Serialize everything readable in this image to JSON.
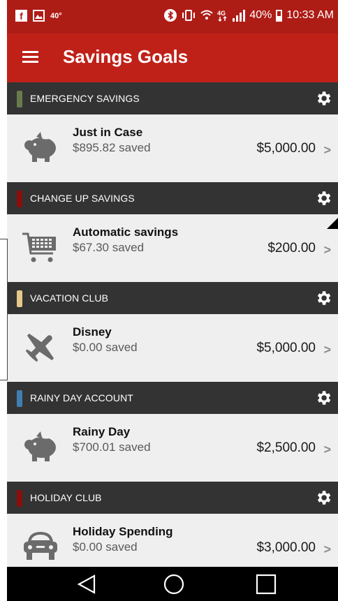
{
  "status_bar": {
    "temperature": "40°",
    "battery_percent": "40%",
    "time": "10:33 AM",
    "icons": [
      "facebook-icon",
      "gallery-icon",
      "bluetooth-icon",
      "vibrate-icon",
      "wifi-icon",
      "lte-icon",
      "signal-icon",
      "battery-icon"
    ]
  },
  "app_bar": {
    "title": "Savings Goals",
    "menu_icon": "hamburger-menu-icon"
  },
  "sections": [
    {
      "category": "EMERGENCY SAVINGS",
      "swatch_color": "#6b7a4d",
      "goal": {
        "name": "Just in Case",
        "saved": "$895.82 saved",
        "target": "$5,000.00",
        "icon": "piggy-bank-icon"
      }
    },
    {
      "category": "CHANGE UP SAVINGS",
      "swatch_color": "#8a0e0e",
      "goal": {
        "name": "Automatic savings",
        "saved": "$67.30 saved",
        "target": "$200.00",
        "icon": "shopping-cart-icon"
      }
    },
    {
      "category": "VACATION CLUB",
      "swatch_color": "#e6c88a",
      "goal": {
        "name": "Disney",
        "saved": "$0.00 saved",
        "target": "$5,000.00",
        "icon": "airplane-icon"
      }
    },
    {
      "category": "RAINY DAY ACCOUNT",
      "swatch_color": "#3f7fb0",
      "goal": {
        "name": "Rainy Day",
        "saved": "$700.01 saved",
        "target": "$2,500.00",
        "icon": "piggy-bank-icon"
      }
    },
    {
      "category": "HOLIDAY CLUB",
      "swatch_color": "#8a0e0e",
      "goal": {
        "name": "Holiday Spending",
        "saved": "$0.00 saved",
        "target": "$3,000.00",
        "icon": "car-icon"
      }
    }
  ],
  "colors": {
    "status_bar": "#ae1c16",
    "app_bar": "#bf2119",
    "category_bar": "#333333",
    "row_background": "#efefef"
  },
  "nav_bar": {
    "buttons": [
      "back-icon",
      "home-icon",
      "recents-icon"
    ]
  }
}
